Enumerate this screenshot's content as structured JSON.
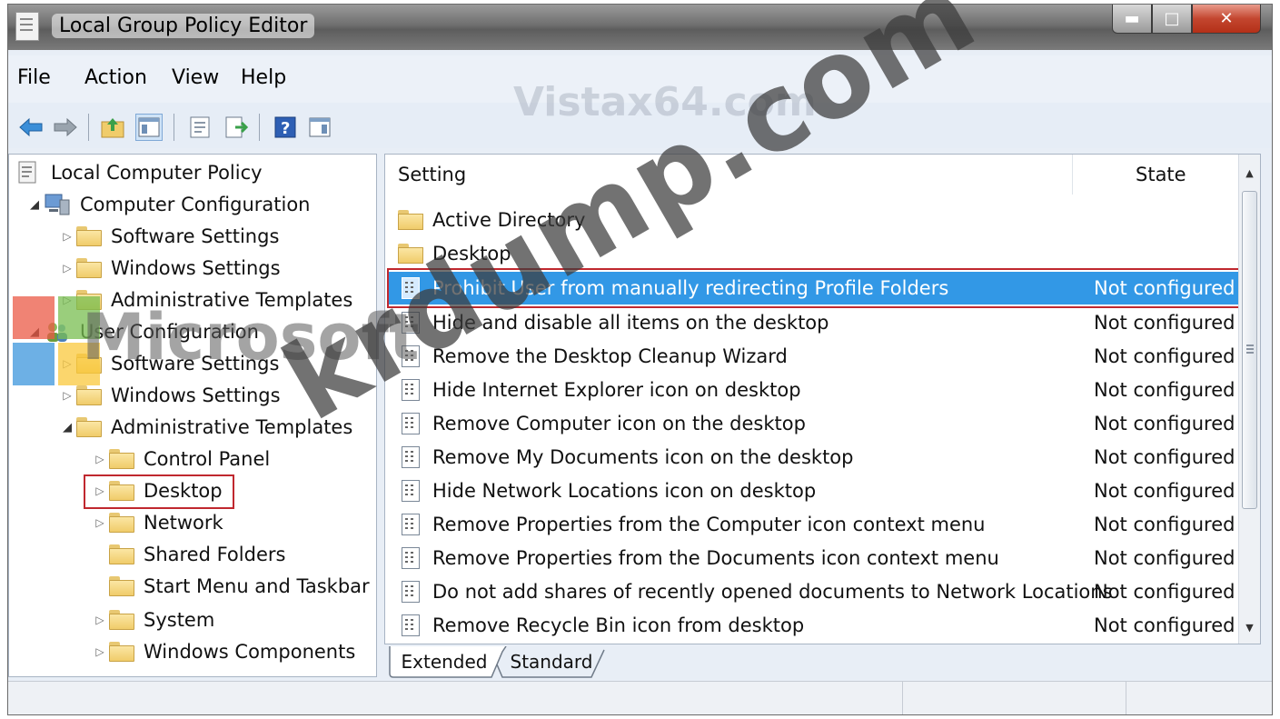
{
  "window": {
    "title": "Local Group Policy Editor"
  },
  "menubar": {
    "items": [
      "File",
      "Action",
      "View",
      "Help"
    ]
  },
  "toolbar": {
    "icons": [
      "back-arrow-icon",
      "forward-arrow-icon",
      "up-folder-icon",
      "show-hide-tree-icon",
      "properties-icon",
      "export-list-icon",
      "help-icon",
      "show-action-pane-icon"
    ]
  },
  "tree": {
    "items": [
      {
        "label": "Local Computer Policy",
        "depth": 0,
        "expander": ""
      },
      {
        "label": "Computer Configuration",
        "depth": 1,
        "expander": "open"
      },
      {
        "label": "Software Settings",
        "depth": 2,
        "expander": "closed"
      },
      {
        "label": "Windows Settings",
        "depth": 2,
        "expander": "closed"
      },
      {
        "label": "Administrative Templates",
        "depth": 2,
        "expander": "closed"
      },
      {
        "label": "User Configuration",
        "depth": 1,
        "expander": "open"
      },
      {
        "label": "Software Settings",
        "depth": 2,
        "expander": "closed"
      },
      {
        "label": "Windows Settings",
        "depth": 2,
        "expander": "closed"
      },
      {
        "label": "Administrative Templates",
        "depth": 2,
        "expander": "open"
      },
      {
        "label": "Control Panel",
        "depth": 3,
        "expander": "closed"
      },
      {
        "label": "Desktop",
        "depth": 3,
        "expander": "closed"
      },
      {
        "label": "Network",
        "depth": 3,
        "expander": "closed"
      },
      {
        "label": "Shared Folders",
        "depth": 3,
        "expander": ""
      },
      {
        "label": "Start Menu and Taskbar",
        "depth": 3,
        "expander": ""
      },
      {
        "label": "System",
        "depth": 3,
        "expander": "closed"
      },
      {
        "label": "Windows Components",
        "depth": 3,
        "expander": "closed"
      }
    ]
  },
  "list": {
    "columns": {
      "setting": "Setting",
      "state": "State"
    },
    "rows": [
      {
        "name": "Active Directory",
        "state": "",
        "type": "folder"
      },
      {
        "name": "Desktop",
        "state": "",
        "type": "folder"
      },
      {
        "name": "Prohibit User from manually redirecting Profile Folders",
        "state": "Not configured",
        "type": "policy",
        "selected": true
      },
      {
        "name": "Hide and disable all items on the desktop",
        "state": "Not configured",
        "type": "policy"
      },
      {
        "name": "Remove the Desktop Cleanup Wizard",
        "state": "Not configured",
        "type": "policy"
      },
      {
        "name": "Hide Internet Explorer icon on desktop",
        "state": "Not configured",
        "type": "policy"
      },
      {
        "name": "Remove Computer icon on the desktop",
        "state": "Not configured",
        "type": "policy"
      },
      {
        "name": "Remove My Documents icon on the desktop",
        "state": "Not configured",
        "type": "policy"
      },
      {
        "name": "Hide Network Locations icon on desktop",
        "state": "Not configured",
        "type": "policy"
      },
      {
        "name": "Remove Properties from the Computer icon context menu",
        "state": "Not configured",
        "type": "policy"
      },
      {
        "name": "Remove Properties from the Documents icon context menu",
        "state": "Not configured",
        "type": "policy"
      },
      {
        "name": "Do not add shares of recently opened documents to Network Locations",
        "state": "Not configured",
        "type": "policy"
      },
      {
        "name": "Remove Recycle Bin icon from desktop",
        "state": "Not configured",
        "type": "policy"
      }
    ]
  },
  "tabs": [
    "Extended",
    "Standard"
  ],
  "watermarks": {
    "main": "krdump.com",
    "site": "Vistax64.com",
    "brand": "Microsoft"
  },
  "colors": {
    "selection": "#3298e6",
    "highlight_border": "#c0282f",
    "window_bg": "#e8eef6"
  }
}
